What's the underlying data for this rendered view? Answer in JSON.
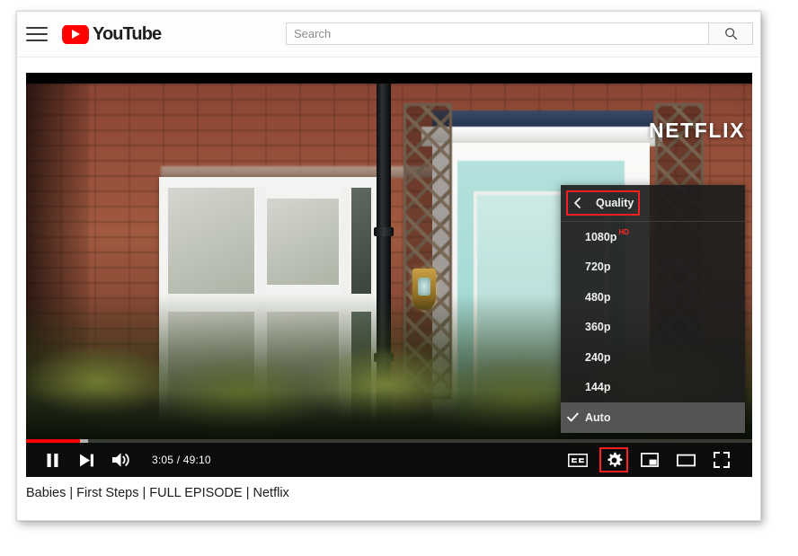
{
  "header": {
    "menu_icon": "hamburger-menu-icon",
    "logo_text": "YouTube",
    "logo_icon": "youtube-play-icon",
    "search": {
      "placeholder": "Search",
      "value": "",
      "button_icon": "search-icon"
    }
  },
  "player": {
    "watermark": "NETFLIX",
    "time_display": "3:05 / 49:10",
    "current_time": "3:05",
    "duration": "49:10",
    "progress_percent": 7.4,
    "buffered_percent": 8.6,
    "accent_color": "#ff0000",
    "highlight_color": "#ff2020",
    "left_controls": [
      {
        "name": "pause-button",
        "icon": "pause-icon",
        "label": "Pause"
      },
      {
        "name": "next-button",
        "icon": "next-track-icon",
        "label": "Next"
      },
      {
        "name": "volume-button",
        "icon": "volume-high-icon",
        "label": "Volume"
      }
    ],
    "right_controls": [
      {
        "name": "subtitles-button",
        "icon": "closed-captions-icon",
        "label": "CC"
      },
      {
        "name": "settings-button",
        "icon": "gear-icon",
        "label": "Settings",
        "highlighted": true
      },
      {
        "name": "miniplayer-button",
        "icon": "miniplayer-icon",
        "label": "Miniplayer"
      },
      {
        "name": "theater-button",
        "icon": "theater-mode-icon",
        "label": "Theater mode"
      },
      {
        "name": "fullscreen-button",
        "icon": "fullscreen-icon",
        "label": "Full screen"
      }
    ]
  },
  "settings_menu": {
    "header_label": "Quality",
    "back_icon": "chevron-left-icon",
    "header_highlighted": true,
    "items": [
      {
        "label": "1080p",
        "badge": "HD",
        "selected": false
      },
      {
        "label": "720p",
        "badge": "",
        "selected": false
      },
      {
        "label": "480p",
        "badge": "",
        "selected": false
      },
      {
        "label": "360p",
        "badge": "",
        "selected": false
      },
      {
        "label": "240p",
        "badge": "",
        "selected": false
      },
      {
        "label": "144p",
        "badge": "",
        "selected": false
      },
      {
        "label": "Auto",
        "badge": "",
        "selected": true
      }
    ]
  },
  "video": {
    "title": "Babies | First Steps | FULL EPISODE | Netflix"
  }
}
